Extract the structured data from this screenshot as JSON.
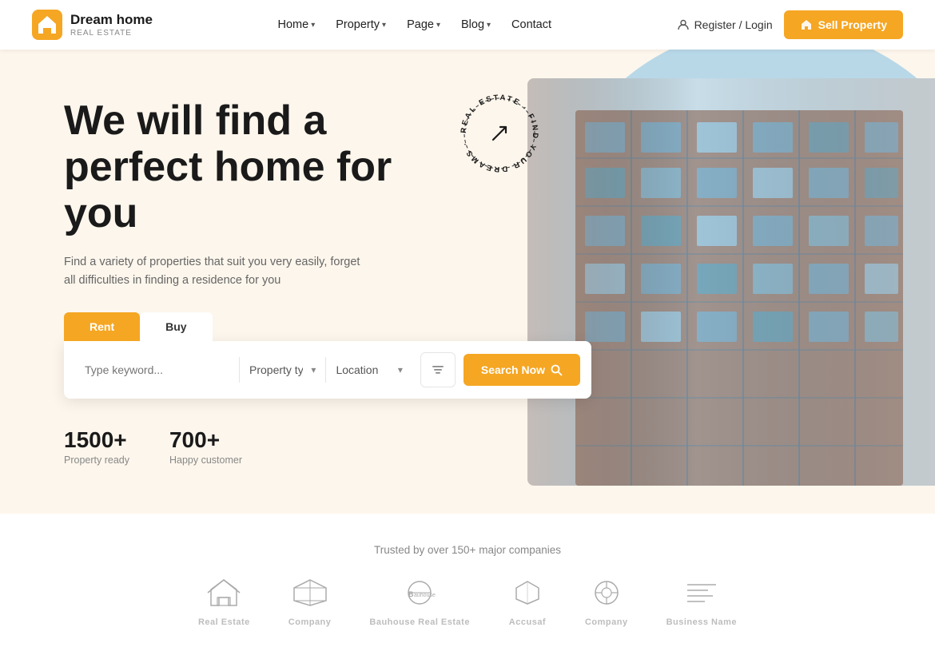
{
  "brand": {
    "title": "Dream home",
    "subtitle": "Real Estate",
    "logo_icon": "🏠"
  },
  "navbar": {
    "links": [
      {
        "id": "home",
        "label": "Home",
        "has_dropdown": true
      },
      {
        "id": "property",
        "label": "Property",
        "has_dropdown": true
      },
      {
        "id": "page",
        "label": "Page",
        "has_dropdown": true
      },
      {
        "id": "blog",
        "label": "Blog",
        "has_dropdown": true
      },
      {
        "id": "contact",
        "label": "Contact",
        "has_dropdown": false
      }
    ],
    "register_label": "Register / Login",
    "sell_label": "Sell Property"
  },
  "hero": {
    "title": "We will find a perfect home for you",
    "description": "Find a variety of properties that suit you very easily, forget all difficulties in finding a residence for you",
    "tabs": [
      {
        "id": "rent",
        "label": "Rent",
        "active": true
      },
      {
        "id": "buy",
        "label": "Buy",
        "active": false
      }
    ],
    "search": {
      "keyword_placeholder": "Type keyword...",
      "property_type_placeholder": "Property type",
      "location_placeholder": "Location",
      "search_btn_label": "Search Now"
    },
    "stats": [
      {
        "value": "1500+",
        "label": "Property ready"
      },
      {
        "value": "700+",
        "label": "Happy customer"
      }
    ],
    "circular_text": "ESTATE · FIND YOUR DREAMS ·"
  },
  "trusted": {
    "title": "Trusted by over 150+ major companies",
    "logos": [
      {
        "id": "real-estate",
        "name": "Real Estate",
        "icon": "🏘"
      },
      {
        "id": "company1",
        "name": "Company",
        "icon": "◈"
      },
      {
        "id": "bauhouse",
        "name": "Bauhouse Real Estate",
        "icon": "⬡"
      },
      {
        "id": "accusaf",
        "name": "Accusaf",
        "icon": "⬟"
      },
      {
        "id": "company2",
        "name": "Company",
        "icon": "⊕"
      },
      {
        "id": "business",
        "name": "Business Name",
        "icon": "≋"
      }
    ]
  },
  "colors": {
    "accent": "#f5a623",
    "bg_hero": "#fdf6ec",
    "circle_bg": "#b8d8e8"
  }
}
